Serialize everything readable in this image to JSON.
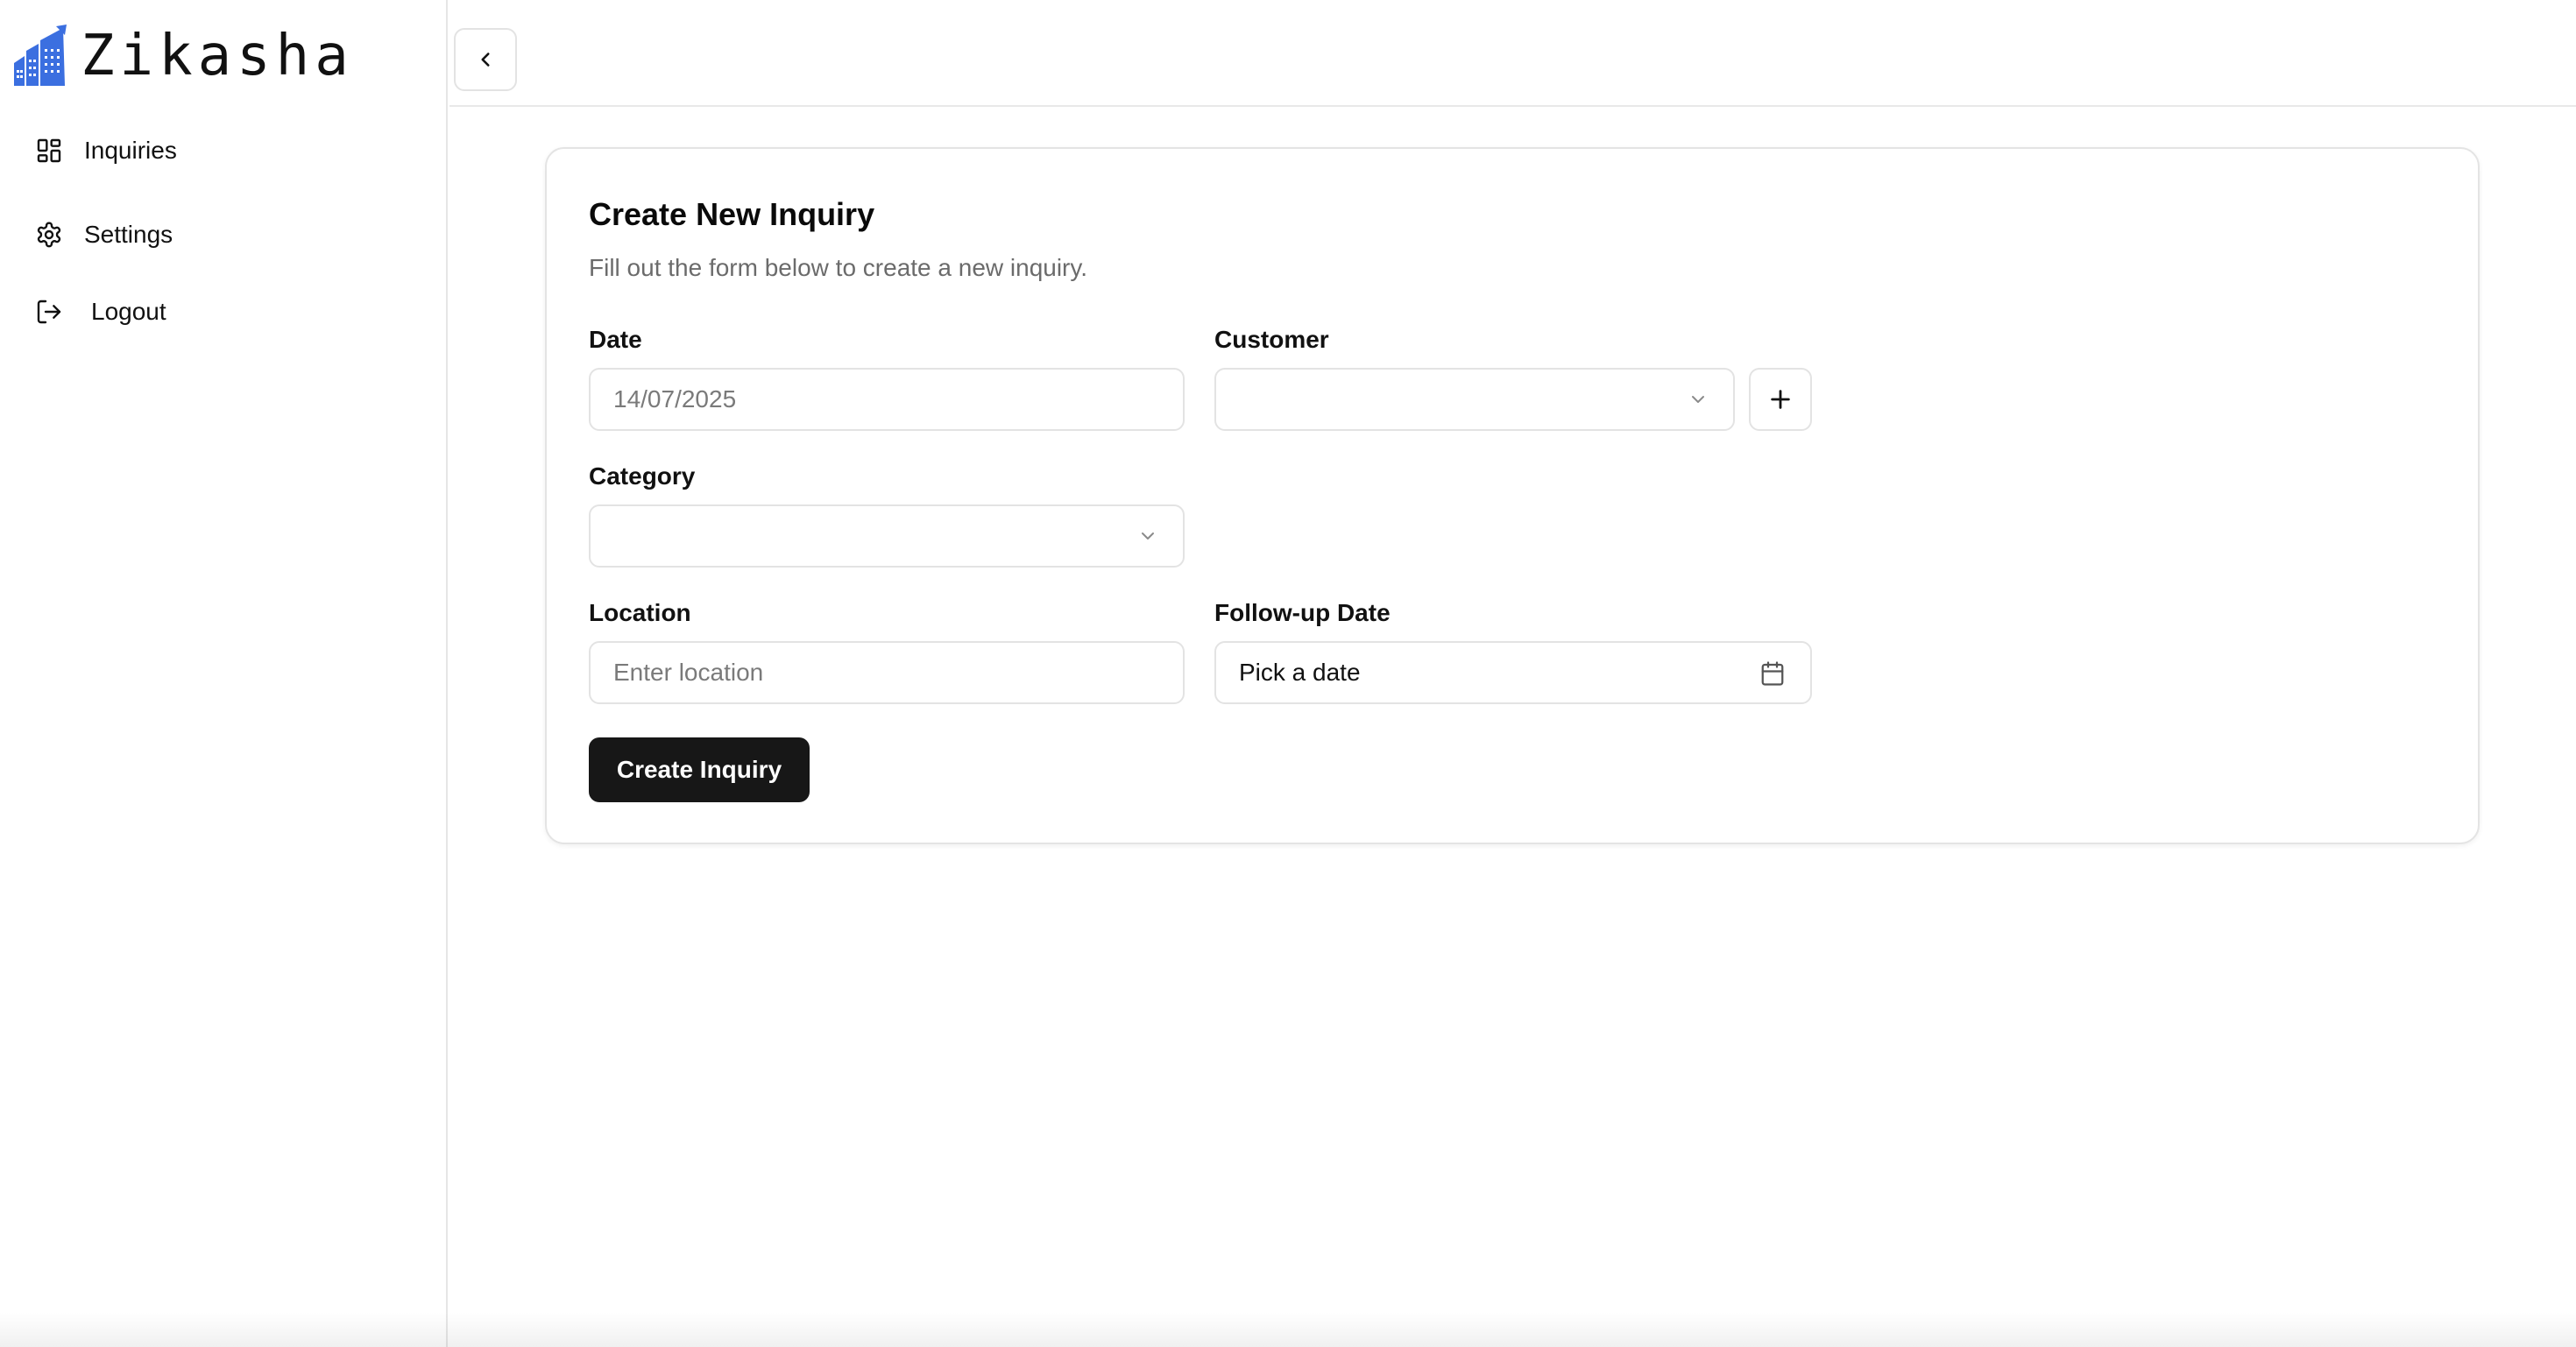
{
  "app": {
    "brand_name": "Zikasha",
    "brand_logo_icon": "building-chart-icon",
    "accent_color": "#3b6fe0"
  },
  "sidebar": {
    "items": [
      {
        "label": "Inquiries",
        "icon": "grid-icon"
      },
      {
        "label": "Settings",
        "icon": "gear-icon"
      },
      {
        "label": "Logout",
        "icon": "logout-icon"
      }
    ]
  },
  "header": {
    "collapse_icon": "chevron-left-icon"
  },
  "form": {
    "title": "Create New Inquiry",
    "subtitle": "Fill out the form below to create a new inquiry.",
    "date": {
      "label": "Date",
      "value": "14/07/2025"
    },
    "customer": {
      "label": "Customer",
      "value": "",
      "add_icon": "plus-icon"
    },
    "category": {
      "label": "Category",
      "value": ""
    },
    "location": {
      "label": "Location",
      "placeholder": "Enter location",
      "value": ""
    },
    "followup": {
      "label": "Follow-up Date",
      "placeholder": "Pick a date",
      "icon": "calendar-icon"
    },
    "submit_label": "Create Inquiry"
  }
}
